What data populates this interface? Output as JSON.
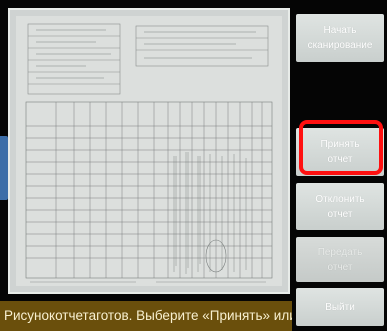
{
  "sidebar": {
    "buttons": [
      {
        "label": "Начать\nсканирование",
        "state": "enabled"
      },
      {
        "label": "Принять\nотчет",
        "state": "enabled"
      },
      {
        "label": "Отклонить\nотчет",
        "state": "enabled"
      },
      {
        "label": "Передать\nотчет",
        "state": "disabled"
      },
      {
        "label": "Выйти",
        "state": "enabled"
      }
    ]
  },
  "status": {
    "message": "Рисунокотчетаготов. Выберите «Принять» или"
  },
  "colors": {
    "highlight": "#ff1010",
    "status_bg": "#6a4f0c",
    "accent_tab": "#3d6ea8"
  }
}
